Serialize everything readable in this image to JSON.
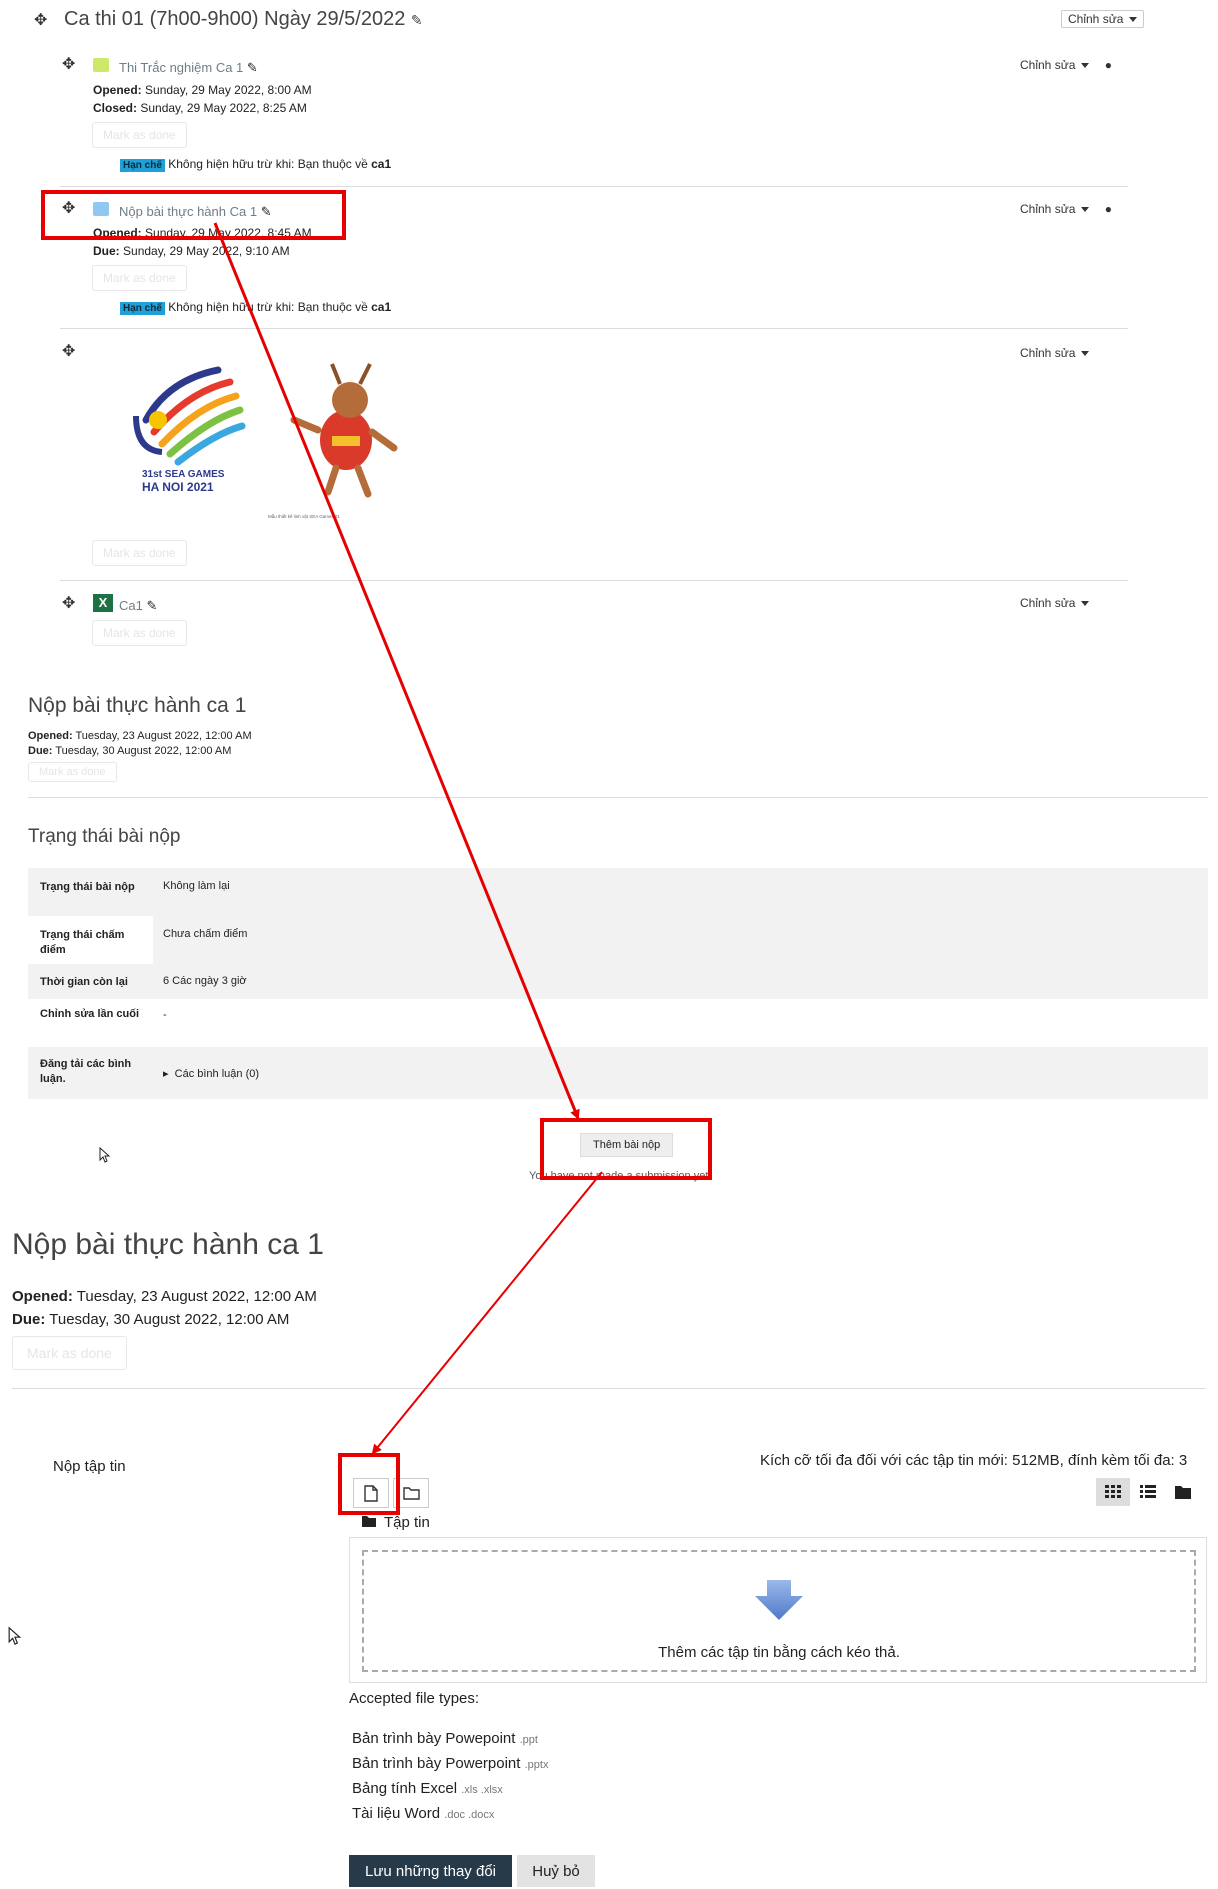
{
  "section": {
    "title": "Ca thi 01 (7h00-9h00) Ngày 29/5/2022",
    "edit_btn": "Chỉnh sửa"
  },
  "activities": [
    {
      "title": "Thi Trắc nghiệm Ca 1",
      "l1": "Opened:",
      "v1": "Sunday, 29 May 2022, 8:00 AM",
      "l2": "Closed:",
      "v2": "Sunday, 29 May 2022, 8:25 AM",
      "mark": "Mark as done",
      "badge": "Hạn chế",
      "restrict": "Không hiện hữu trừ khi: Bạn thuộc về",
      "group": "ca1",
      "edit": "Chỉnh sửa"
    },
    {
      "title": "Nộp bài thực hành Ca 1",
      "l1": "Opened:",
      "v1": "Sunday, 29 May 2022, 8:45 AM",
      "l2": "Due:",
      "v2": "Sunday, 29 May 2022, 9:10 AM",
      "mark": "Mark as done",
      "badge": "Hạn chế",
      "restrict": "Không hiện hữu trừ khi: Bạn thuộc về",
      "group": "ca1",
      "edit": "Chỉnh sửa"
    },
    {
      "mark": "Mark as done",
      "edit": "Chỉnh sửa",
      "logo": {
        "line1": "31st SEA GAMES",
        "line2": "HA NOI 2021",
        "caption": "Mẫu thiết kế linh vật SEA Games 31"
      }
    },
    {
      "title": "Ca1",
      "mark": "Mark as done",
      "edit": "Chỉnh sửa"
    }
  ],
  "assign_small": {
    "title": "Nộp bài thực hành ca 1",
    "l1": "Opened:",
    "v1": "Tuesday, 23 August 2022, 12:00 AM",
    "l2": "Due:",
    "v2": "Tuesday, 30 August 2022, 12:00 AM",
    "mark": "Mark as done"
  },
  "status": {
    "heading": "Trạng thái bài nộp",
    "rows": [
      {
        "label": "Trạng thái bài nộp",
        "value": "Không làm lại"
      },
      {
        "label": "Trạng thái chấm điểm",
        "value": "Chưa chấm điểm"
      },
      {
        "label": "Thời gian còn lại",
        "value": "6 Các ngày 3 giờ"
      },
      {
        "label": "Chỉnh sửa lần cuối",
        "value": "-"
      },
      {
        "label": "Đăng tải các bình luận.",
        "value": "Các bình luận (0)"
      }
    ],
    "add_btn": "Thêm bài nộp",
    "note": "You have not made a submission yet."
  },
  "assign_big": {
    "title": "Nộp bài thực hành ca 1",
    "l1": "Opened:",
    "v1": "Tuesday, 23 August 2022, 12:00 AM",
    "l2": "Due:",
    "v2": "Tuesday, 30 August 2022, 12:00 AM",
    "mark": "Mark as done"
  },
  "filepicker": {
    "label": "Nộp tập tin",
    "limit": "Kích cỡ tối đa đối với các tập tin mới: 512MB, đính kèm tối đa: 3",
    "folder": "Tập tin",
    "drop": "Thêm các tập tin bằng cách kéo thả.",
    "accepted_title": "Accepted file types:",
    "types": [
      {
        "name": "Bản trình bày Powepoint",
        "ext": ".ppt"
      },
      {
        "name": "Bản trình bày Powerpoint",
        "ext": ".pptx"
      },
      {
        "name": "Bảng tính Excel",
        "ext": ".xls .xlsx"
      },
      {
        "name": "Tài liệu Word",
        "ext": ".doc .docx"
      }
    ],
    "save": "Lưu những thay đổi",
    "cancel": "Huỷ bỏ"
  },
  "colors": {
    "highlight": "#e60000",
    "badge": "#1fa0d8",
    "primary_btn": "#263a4a",
    "table_stripe": "#f2f2f2"
  }
}
